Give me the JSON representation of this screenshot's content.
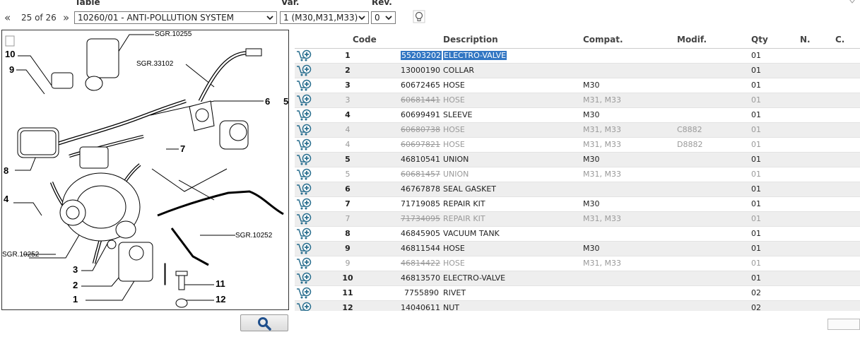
{
  "toolbar": {
    "table_label": "Table",
    "var_label": "Var.",
    "rev_label": "Rev.",
    "first_nav": "«",
    "prev_next_nav": "»",
    "pager": "25 of 26",
    "table_value": "10260/01 - ANTI-POLLUTION SYSTEM",
    "var_value": "1 (M30,M31,M33)",
    "rev_value": "0",
    "icons": {
      "hint": "lightbulb-icon",
      "dropdown": "chevron-down-icon",
      "zoom": "magnifier-icon",
      "cart": "add-to-cart-icon"
    }
  },
  "drawing": {
    "callouts": [
      "10",
      "9",
      "8",
      "4",
      "3",
      "2",
      "1",
      "11",
      "12",
      "7",
      "6",
      "5"
    ],
    "sgr_refs": [
      "SGR.10255",
      "SGR.33102",
      "SGR.10252",
      "SGR.10252"
    ]
  },
  "table": {
    "columns": [
      "Code",
      "Description",
      "Compat.",
      "Modif.",
      "Qty",
      "N.",
      "C."
    ],
    "rows": [
      {
        "num": "1",
        "code": "55203202",
        "desc": "ELECTRO-VALVE",
        "compat": "",
        "modif": "",
        "qty": "01",
        "superseded": false,
        "selected": true
      },
      {
        "num": "2",
        "code": "13000190",
        "desc": "COLLAR",
        "compat": "",
        "modif": "",
        "qty": "01",
        "superseded": false
      },
      {
        "num": "3",
        "code": "60672465",
        "desc": "HOSE",
        "compat": "M30",
        "modif": "",
        "qty": "01",
        "superseded": false
      },
      {
        "num": "3",
        "code": "60681441",
        "desc": "HOSE",
        "compat": "M31, M33",
        "modif": "",
        "qty": "01",
        "superseded": true
      },
      {
        "num": "4",
        "code": "60699491",
        "desc": "SLEEVE",
        "compat": "M30",
        "modif": "",
        "qty": "01",
        "superseded": false
      },
      {
        "num": "4",
        "code": "60680738",
        "desc": "HOSE",
        "compat": "M31, M33",
        "modif": "C8882",
        "qty": "01",
        "superseded": true
      },
      {
        "num": "4",
        "code": "60697821",
        "desc": "HOSE",
        "compat": "M31, M33",
        "modif": "D8882",
        "qty": "01",
        "superseded": true
      },
      {
        "num": "5",
        "code": "46810541",
        "desc": "UNION",
        "compat": "M30",
        "modif": "",
        "qty": "01",
        "superseded": false
      },
      {
        "num": "5",
        "code": "60681457",
        "desc": "UNION",
        "compat": "M31, M33",
        "modif": "",
        "qty": "01",
        "superseded": true
      },
      {
        "num": "6",
        "code": "46767878",
        "desc": "SEAL GASKET",
        "compat": "",
        "modif": "",
        "qty": "01",
        "superseded": false
      },
      {
        "num": "7",
        "code": "71719085",
        "desc": "REPAIR KIT",
        "compat": "M30",
        "modif": "",
        "qty": "01",
        "superseded": false
      },
      {
        "num": "7",
        "code": "71734095",
        "desc": "REPAIR KIT",
        "compat": "M31, M33",
        "modif": "",
        "qty": "01",
        "superseded": true
      },
      {
        "num": "8",
        "code": "46845905",
        "desc": "VACUUM TANK",
        "compat": "",
        "modif": "",
        "qty": "01",
        "superseded": false
      },
      {
        "num": "9",
        "code": "46811544",
        "desc": "HOSE",
        "compat": "M30",
        "modif": "",
        "qty": "01",
        "superseded": false
      },
      {
        "num": "9",
        "code": "46814422",
        "desc": "HOSE",
        "compat": "M31, M33",
        "modif": "",
        "qty": "01",
        "superseded": true
      },
      {
        "num": "10",
        "code": "46813570",
        "desc": "ELECTRO-VALVE",
        "compat": "",
        "modif": "",
        "qty": "01",
        "superseded": false
      },
      {
        "num": "11",
        "code": "7755890",
        "desc": "RIVET",
        "compat": "",
        "modif": "",
        "qty": "02",
        "superseded": false
      },
      {
        "num": "12",
        "code": "14040611",
        "desc": "NUT",
        "compat": "",
        "modif": "",
        "qty": "02",
        "superseded": false
      }
    ]
  }
}
